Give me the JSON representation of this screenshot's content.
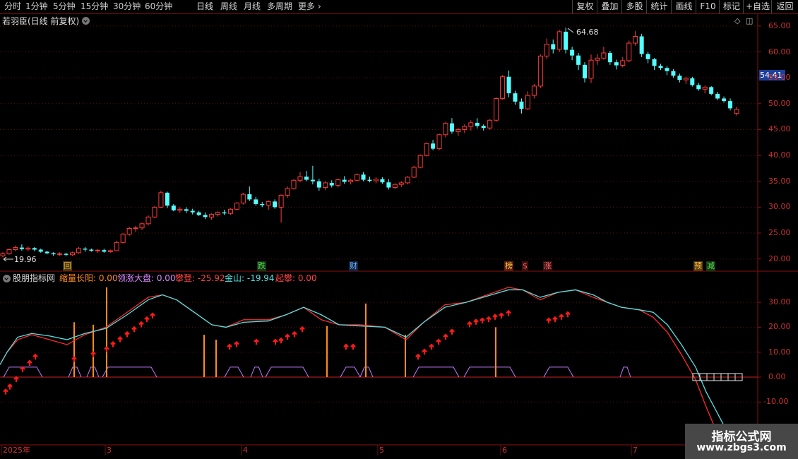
{
  "toolbar": {
    "periods": [
      "分时",
      "1分钟",
      "5分钟",
      "15分钟",
      "30分钟",
      "60分钟",
      "日线",
      "周线",
      "月线",
      "多周期"
    ],
    "active_period": "日线",
    "more_label": "更多",
    "more_icon": "chevron-right-icon",
    "right_buttons": [
      "复权",
      "叠加",
      "多股",
      "统计",
      "画线",
      "F10",
      "标记",
      "+自选",
      "返回"
    ]
  },
  "main_panel": {
    "title": "若羽臣(日线 前复权)",
    "current_price": "54.41",
    "high_label": "64.68",
    "low_label": "19.96",
    "yaxis_labels": [
      "65.00",
      "60.00",
      "55.00",
      "50.00",
      "45.00",
      "40.00",
      "35.00",
      "30.00",
      "25.00",
      "20.00"
    ],
    "markers": [
      {
        "text": "回",
        "color": "#d9a23a",
        "bg": "#4a3a10"
      },
      {
        "text": "跌",
        "color": "#5fdc5f",
        "bg": "#103a10"
      },
      {
        "text": "财",
        "color": "#6fb0ff",
        "bg": "#10243f"
      },
      {
        "text": "榜",
        "color": "#ffcc44",
        "bg": "#5a1c10"
      },
      {
        "text": "$",
        "color": "#ff5a5a",
        "bg": "#3a1010"
      },
      {
        "text": "涨",
        "color": "#ff6a6a",
        "bg": "#3a1010"
      },
      {
        "text": "预",
        "color": "#ffcc44",
        "bg": "#5a3a10"
      },
      {
        "text": "减",
        "color": "#5fdc5f",
        "bg": "#103a10"
      }
    ]
  },
  "indicator_panel": {
    "name": "股朋指标网",
    "fields": [
      {
        "label": "缩量长阳:",
        "value": "0.00",
        "color": "#ff8c1a"
      },
      {
        "label": "领涨大盘:",
        "value": "0.00",
        "color": "#d889ff"
      },
      {
        "label": "攀登:",
        "value": "-25.92",
        "color": "#ff4444"
      },
      {
        "label": "金山:",
        "value": "-19.94",
        "color": "#55e0e0"
      },
      {
        "label": "起攀:",
        "value": "0.00",
        "color": "#ff4444"
      }
    ],
    "yaxis_labels": [
      "30.00",
      "20.00",
      "10.00",
      "0.00",
      "-10.00"
    ]
  },
  "xaxis": {
    "labels": [
      "2025年",
      "3",
      "4",
      "5",
      "6",
      "7"
    ]
  },
  "chart_data": {
    "type": "candlestick",
    "title": "若羽臣(日线 前复权)",
    "ylim": [
      18,
      67
    ],
    "candles": [
      [
        20.6,
        21.3,
        20.3,
        21.0,
        "u"
      ],
      [
        21.0,
        22.0,
        20.8,
        21.8,
        "u"
      ],
      [
        21.8,
        22.6,
        21.5,
        22.2,
        "u"
      ],
      [
        22.2,
        22.8,
        21.6,
        21.9,
        "d"
      ],
      [
        21.9,
        22.4,
        21.5,
        22.1,
        "u"
      ],
      [
        22.1,
        22.3,
        21.5,
        21.8,
        "d"
      ],
      [
        21.8,
        22.0,
        21.2,
        21.4,
        "d"
      ],
      [
        21.4,
        21.6,
        20.9,
        21.1,
        "d"
      ],
      [
        21.1,
        21.3,
        20.6,
        20.9,
        "d"
      ],
      [
        20.9,
        21.3,
        20.6,
        21.0,
        "u"
      ],
      [
        21.0,
        21.2,
        20.5,
        20.8,
        "d"
      ],
      [
        20.8,
        21.4,
        20.6,
        21.2,
        "u"
      ],
      [
        21.2,
        22.3,
        21.0,
        22.0,
        "u"
      ],
      [
        22.0,
        22.3,
        21.4,
        21.8,
        "d"
      ],
      [
        21.8,
        22.0,
        21.4,
        21.6,
        "d"
      ],
      [
        21.6,
        21.9,
        21.2,
        21.7,
        "u"
      ],
      [
        21.7,
        22.0,
        21.2,
        21.4,
        "d"
      ],
      [
        21.4,
        21.8,
        21.2,
        21.6,
        "u"
      ],
      [
        21.6,
        23.5,
        21.5,
        23.2,
        "u"
      ],
      [
        23.2,
        25.0,
        23.0,
        24.8,
        "u"
      ],
      [
        24.8,
        26.2,
        24.5,
        25.9,
        "u"
      ],
      [
        25.9,
        26.4,
        25.2,
        26.0,
        "u"
      ],
      [
        26.0,
        27.0,
        25.6,
        26.8,
        "u"
      ],
      [
        26.8,
        28.4,
        26.5,
        28.1,
        "u"
      ],
      [
        28.1,
        30.2,
        27.9,
        30.0,
        "u"
      ],
      [
        30.0,
        33.2,
        29.8,
        32.8,
        "u"
      ],
      [
        32.8,
        33.0,
        29.8,
        30.3,
        "d"
      ],
      [
        30.3,
        30.6,
        29.2,
        29.4,
        "d"
      ],
      [
        29.4,
        30.0,
        28.9,
        29.6,
        "u"
      ],
      [
        29.6,
        30.0,
        28.9,
        29.3,
        "d"
      ],
      [
        29.3,
        29.7,
        28.6,
        29.0,
        "d"
      ],
      [
        29.0,
        29.3,
        28.3,
        28.5,
        "d"
      ],
      [
        28.5,
        29.0,
        27.7,
        28.1,
        "d"
      ],
      [
        28.1,
        28.8,
        27.6,
        28.6,
        "u"
      ],
      [
        28.6,
        29.2,
        28.2,
        29.0,
        "u"
      ],
      [
        29.0,
        29.5,
        28.5,
        28.8,
        "d"
      ],
      [
        28.8,
        29.8,
        28.5,
        29.6,
        "u"
      ],
      [
        29.6,
        31.0,
        29.4,
        30.8,
        "u"
      ],
      [
        30.8,
        32.8,
        30.5,
        32.5,
        "u"
      ],
      [
        32.5,
        34.0,
        31.2,
        31.5,
        "d"
      ],
      [
        31.5,
        32.0,
        30.3,
        30.6,
        "d"
      ],
      [
        30.6,
        31.0,
        30.0,
        30.4,
        "d"
      ],
      [
        30.4,
        31.3,
        29.5,
        31.1,
        "u"
      ],
      [
        31.1,
        31.5,
        29.7,
        30.0,
        "d"
      ],
      [
        30.0,
        32.5,
        27.0,
        32.3,
        "u"
      ],
      [
        32.3,
        34.0,
        31.8,
        33.6,
        "u"
      ],
      [
        33.6,
        35.4,
        33.4,
        35.2,
        "u"
      ],
      [
        35.2,
        36.8,
        34.8,
        35.9,
        "u"
      ],
      [
        35.9,
        37.0,
        35.0,
        35.3,
        "d"
      ],
      [
        35.3,
        38.0,
        34.4,
        35.0,
        "d"
      ],
      [
        35.0,
        35.5,
        33.2,
        33.8,
        "d"
      ],
      [
        33.8,
        35.0,
        33.3,
        34.7,
        "u"
      ],
      [
        34.7,
        35.2,
        33.8,
        34.2,
        "d"
      ],
      [
        34.2,
        35.5,
        33.8,
        35.3,
        "u"
      ],
      [
        35.3,
        36.0,
        34.5,
        34.9,
        "d"
      ],
      [
        34.9,
        35.5,
        34.4,
        35.2,
        "u"
      ],
      [
        35.2,
        36.5,
        35.0,
        36.3,
        "u"
      ],
      [
        36.3,
        36.8,
        35.0,
        35.3,
        "d"
      ],
      [
        35.3,
        35.9,
        34.8,
        35.1,
        "d"
      ],
      [
        35.1,
        35.8,
        34.6,
        35.4,
        "u"
      ],
      [
        35.4,
        35.8,
        34.5,
        34.8,
        "d"
      ],
      [
        34.8,
        35.4,
        33.4,
        33.8,
        "d"
      ],
      [
        33.8,
        34.6,
        33.5,
        34.4,
        "u"
      ],
      [
        34.4,
        35.0,
        33.9,
        34.7,
        "u"
      ],
      [
        34.7,
        36.0,
        34.4,
        35.8,
        "u"
      ],
      [
        35.8,
        38.0,
        35.6,
        37.7,
        "u"
      ],
      [
        37.7,
        40.2,
        37.5,
        40.0,
        "u"
      ],
      [
        40.0,
        42.5,
        39.8,
        42.3,
        "u"
      ],
      [
        42.3,
        43.0,
        41.0,
        41.3,
        "d"
      ],
      [
        41.3,
        44.2,
        41.0,
        44.0,
        "u"
      ],
      [
        44.0,
        46.5,
        43.5,
        46.2,
        "u"
      ],
      [
        46.2,
        47.2,
        44.2,
        44.6,
        "d"
      ],
      [
        44.6,
        45.3,
        43.8,
        45.0,
        "u"
      ],
      [
        45.0,
        46.0,
        44.3,
        45.6,
        "u"
      ],
      [
        45.6,
        46.8,
        44.8,
        46.3,
        "u"
      ],
      [
        46.3,
        47.2,
        45.2,
        45.7,
        "d"
      ],
      [
        45.7,
        46.0,
        44.8,
        45.3,
        "d"
      ],
      [
        45.3,
        47.0,
        45.0,
        46.8,
        "u"
      ],
      [
        46.8,
        51.2,
        46.5,
        51.0,
        "u"
      ],
      [
        51.0,
        55.5,
        50.8,
        55.2,
        "u"
      ],
      [
        55.2,
        56.4,
        51.2,
        52.0,
        "d"
      ],
      [
        52.0,
        52.5,
        49.8,
        50.4,
        "d"
      ],
      [
        50.4,
        51.0,
        48.1,
        49.0,
        "d"
      ],
      [
        49.0,
        52.4,
        48.8,
        51.6,
        "u"
      ],
      [
        51.6,
        53.8,
        51.0,
        53.4,
        "u"
      ],
      [
        53.4,
        59.5,
        53.0,
        59.2,
        "u"
      ],
      [
        59.2,
        62.6,
        58.6,
        61.5,
        "u"
      ],
      [
        61.5,
        62.4,
        59.7,
        60.5,
        "d"
      ],
      [
        60.5,
        64.2,
        60.0,
        63.9,
        "u"
      ],
      [
        63.9,
        64.68,
        59.7,
        60.4,
        "d"
      ],
      [
        60.4,
        61.0,
        58.4,
        59.3,
        "d"
      ],
      [
        59.3,
        59.8,
        56.5,
        57.5,
        "d"
      ],
      [
        57.5,
        58.0,
        54.1,
        54.9,
        "d"
      ],
      [
        54.9,
        59.5,
        54.0,
        58.4,
        "u"
      ],
      [
        58.4,
        59.6,
        57.5,
        58.8,
        "u"
      ],
      [
        58.8,
        61.0,
        58.5,
        59.8,
        "u"
      ],
      [
        59.8,
        60.2,
        57.5,
        58.0,
        "d"
      ],
      [
        58.0,
        58.5,
        56.6,
        57.4,
        "d"
      ],
      [
        57.4,
        59.0,
        57.0,
        58.3,
        "u"
      ],
      [
        58.3,
        62.2,
        58.0,
        61.7,
        "u"
      ],
      [
        61.7,
        64.0,
        61.2,
        63.0,
        "u"
      ],
      [
        63.0,
        63.5,
        59.0,
        59.6,
        "d"
      ],
      [
        59.6,
        60.0,
        57.8,
        58.6,
        "d"
      ],
      [
        58.6,
        58.8,
        56.5,
        57.3,
        "d"
      ],
      [
        57.3,
        57.7,
        56.5,
        56.9,
        "d"
      ],
      [
        56.9,
        57.3,
        55.5,
        56.3,
        "d"
      ],
      [
        56.3,
        56.7,
        55.0,
        55.4,
        "d"
      ],
      [
        55.4,
        55.8,
        54.1,
        54.6,
        "d"
      ],
      [
        54.6,
        55.2,
        53.8,
        54.9,
        "u"
      ],
      [
        54.9,
        55.2,
        53.3,
        53.6,
        "d"
      ],
      [
        53.6,
        54.0,
        52.5,
        52.8,
        "d"
      ],
      [
        52.8,
        53.5,
        52.0,
        53.2,
        "u"
      ],
      [
        53.2,
        53.4,
        51.6,
        51.9,
        "d"
      ],
      [
        51.9,
        52.3,
        50.7,
        51.0,
        "d"
      ],
      [
        51.0,
        51.4,
        50.2,
        50.5,
        "d"
      ],
      [
        50.5,
        51.0,
        48.7,
        49.1,
        "d"
      ],
      [
        48.1,
        49.4,
        47.7,
        48.9,
        "u"
      ]
    ]
  }
}
